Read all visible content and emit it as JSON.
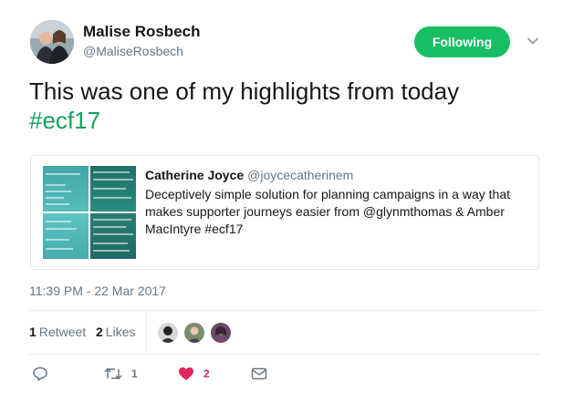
{
  "author": {
    "display_name": "Malise Rosbech",
    "handle": "@MaliseRosbech",
    "avatar_icon": "profile-photo"
  },
  "follow_button": {
    "label": "Following",
    "color": "#17bf63"
  },
  "tweet": {
    "text": "This was one of my highlights from today",
    "hashtag": "#ecf17",
    "hashtag_color": "#17a05e"
  },
  "quoted_tweet": {
    "display_name": "Catherine Joyce",
    "handle": "@joycecatherinem",
    "text": "Deceptively simple solution for planning campaigns in a way that makes supporter journeys easier from @glynmthomas & Amber MacIntyre  #ecf17",
    "image_icon": "presentation-slides-thumbnail"
  },
  "timestamp": "11:39 PM - 22 Mar 2017",
  "stats": {
    "retweets_count": "1",
    "retweets_label": "Retweet",
    "likes_count": "2",
    "likes_label": "Likes"
  },
  "actions": {
    "reply_icon": "reply-icon",
    "retweet_icon": "retweet-icon",
    "retweet_count": "1",
    "like_icon": "heart-icon",
    "like_count": "2",
    "like_color": "#e0245e",
    "dm_icon": "envelope-icon"
  }
}
